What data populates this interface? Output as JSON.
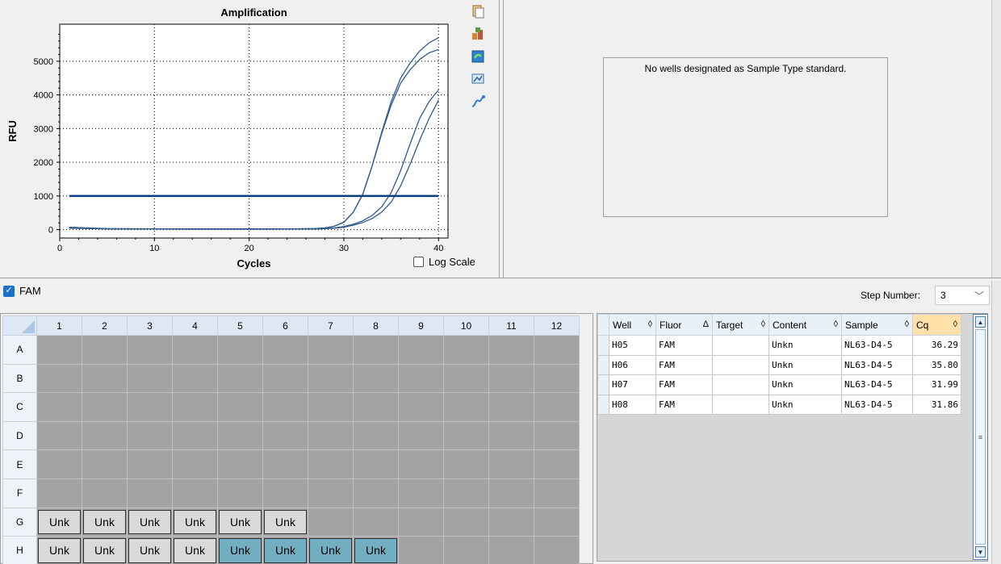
{
  "chart_data": {
    "type": "line",
    "title": "Amplification",
    "xlabel": "Cycles",
    "ylabel": "RFU",
    "xlim": [
      0,
      41
    ],
    "ylim": [
      -250,
      6100
    ],
    "xticks": [
      0,
      10,
      20,
      30,
      40
    ],
    "yticks": [
      0,
      1000,
      2000,
      3000,
      4000,
      5000
    ],
    "grid": true,
    "threshold": 1000,
    "line_color": "#2e5a8f",
    "threshold_color": "#0a3d80",
    "series": [
      {
        "x": [
          1,
          5,
          10,
          15,
          20,
          25,
          27,
          28,
          29,
          30,
          31,
          32,
          33,
          34,
          35,
          36,
          37,
          38,
          39,
          40
        ],
        "y": [
          70,
          30,
          20,
          20,
          20,
          20,
          30,
          50,
          100,
          220,
          520,
          1050,
          1900,
          2900,
          3800,
          4500,
          4950,
          5300,
          5550,
          5700
        ]
      },
      {
        "x": [
          1,
          5,
          10,
          15,
          20,
          25,
          27,
          28,
          29,
          30,
          31,
          32,
          33,
          34,
          35,
          36,
          37,
          38,
          39,
          40
        ],
        "y": [
          60,
          25,
          20,
          15,
          15,
          20,
          30,
          50,
          100,
          220,
          520,
          1050,
          1900,
          2850,
          3700,
          4350,
          4750,
          5050,
          5250,
          5350
        ]
      },
      {
        "x": [
          1,
          5,
          10,
          15,
          20,
          25,
          27,
          28,
          29,
          30,
          31,
          32,
          33,
          34,
          35,
          36,
          37,
          38,
          39,
          40
        ],
        "y": [
          50,
          25,
          15,
          15,
          15,
          15,
          20,
          30,
          50,
          90,
          160,
          260,
          420,
          680,
          1100,
          1750,
          2550,
          3300,
          3800,
          4150
        ]
      },
      {
        "x": [
          1,
          5,
          10,
          15,
          20,
          25,
          27,
          28,
          29,
          30,
          31,
          32,
          33,
          34,
          35,
          36,
          37,
          38,
          39,
          40
        ],
        "y": [
          40,
          20,
          15,
          10,
          10,
          15,
          20,
          25,
          40,
          70,
          130,
          210,
          330,
          520,
          820,
          1300,
          1950,
          2650,
          3300,
          3850
        ]
      }
    ]
  },
  "chart_toolbar": [
    "copy-icon",
    "export-icon",
    "refresh-icon",
    "chart-options-icon",
    "curve-icon"
  ],
  "log_scale_label": "Log Scale",
  "standard_curve": {
    "message": "No wells designated as Sample Type standard."
  },
  "fluor": {
    "label": "FAM",
    "checked": true
  },
  "step": {
    "label": "Step Number:",
    "value": "3"
  },
  "plate": {
    "columns": [
      "1",
      "2",
      "3",
      "4",
      "5",
      "6",
      "7",
      "8",
      "9",
      "10",
      "11",
      "12"
    ],
    "rows": [
      "A",
      "B",
      "C",
      "D",
      "E",
      "F",
      "G",
      "H"
    ],
    "wells": {
      "G1": {
        "label": "Unk",
        "selected": false
      },
      "G2": {
        "label": "Unk",
        "selected": false
      },
      "G3": {
        "label": "Unk",
        "selected": false
      },
      "G4": {
        "label": "Unk",
        "selected": false
      },
      "G5": {
        "label": "Unk",
        "selected": false
      },
      "G6": {
        "label": "Unk",
        "selected": false
      },
      "H1": {
        "label": "Unk",
        "selected": false
      },
      "H2": {
        "label": "Unk",
        "selected": false
      },
      "H3": {
        "label": "Unk",
        "selected": false
      },
      "H4": {
        "label": "Unk",
        "selected": false
      },
      "H5": {
        "label": "Unk",
        "selected": true
      },
      "H6": {
        "label": "Unk",
        "selected": true
      },
      "H7": {
        "label": "Unk",
        "selected": true
      },
      "H8": {
        "label": "Unk",
        "selected": true
      }
    }
  },
  "results": {
    "headers": [
      {
        "label": "Well",
        "sort": "◊"
      },
      {
        "label": "Fluor",
        "sort": "Δ"
      },
      {
        "label": "Target",
        "sort": "◊"
      },
      {
        "label": "Content",
        "sort": "◊"
      },
      {
        "label": "Sample",
        "sort": "◊"
      },
      {
        "label": "Cq",
        "sort": "◊"
      }
    ],
    "rows": [
      [
        "H05",
        "FAM",
        "",
        "Unkn",
        "NL63-D4-5",
        "36.29"
      ],
      [
        "H06",
        "FAM",
        "",
        "Unkn",
        "NL63-D4-5",
        "35.80"
      ],
      [
        "H07",
        "FAM",
        "",
        "Unkn",
        "NL63-D4-5",
        "31.99"
      ],
      [
        "H08",
        "FAM",
        "",
        "Unkn",
        "NL63-D4-5",
        "31.86"
      ]
    ]
  }
}
